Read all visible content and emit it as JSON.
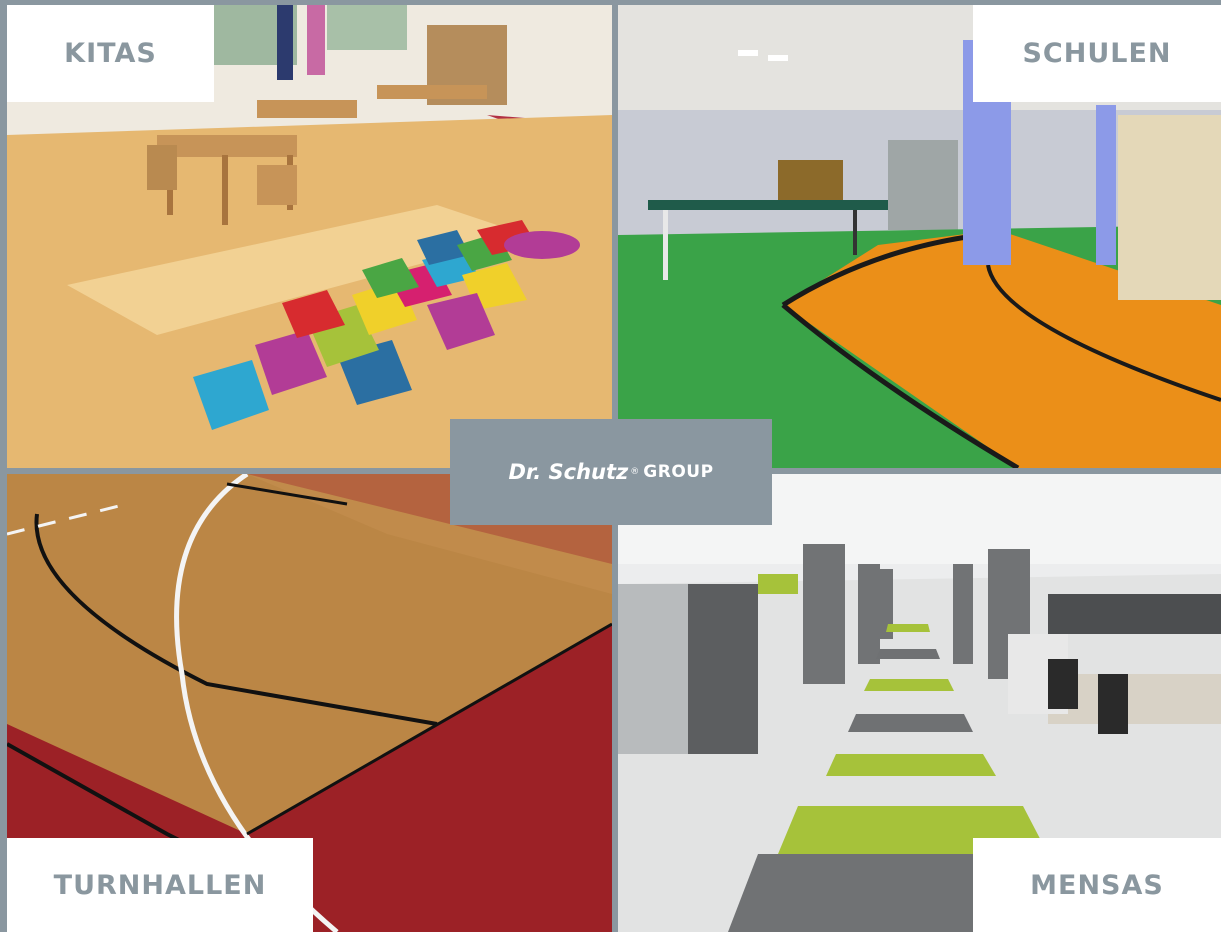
{
  "panels": {
    "kitas": {
      "label": "KITAS"
    },
    "schulen": {
      "label": "SCHULEN"
    },
    "turnhallen": {
      "label": "TURNHALLEN"
    },
    "mensas": {
      "label": "MENSAS"
    }
  },
  "logo": {
    "brand": "Dr. Schutz",
    "reg": "®",
    "group": "GROUP"
  },
  "colors": {
    "background": "#8a97a0",
    "label_bg": "#ffffff",
    "label_text": "#8a979f",
    "logo_text": "#ffffff"
  }
}
